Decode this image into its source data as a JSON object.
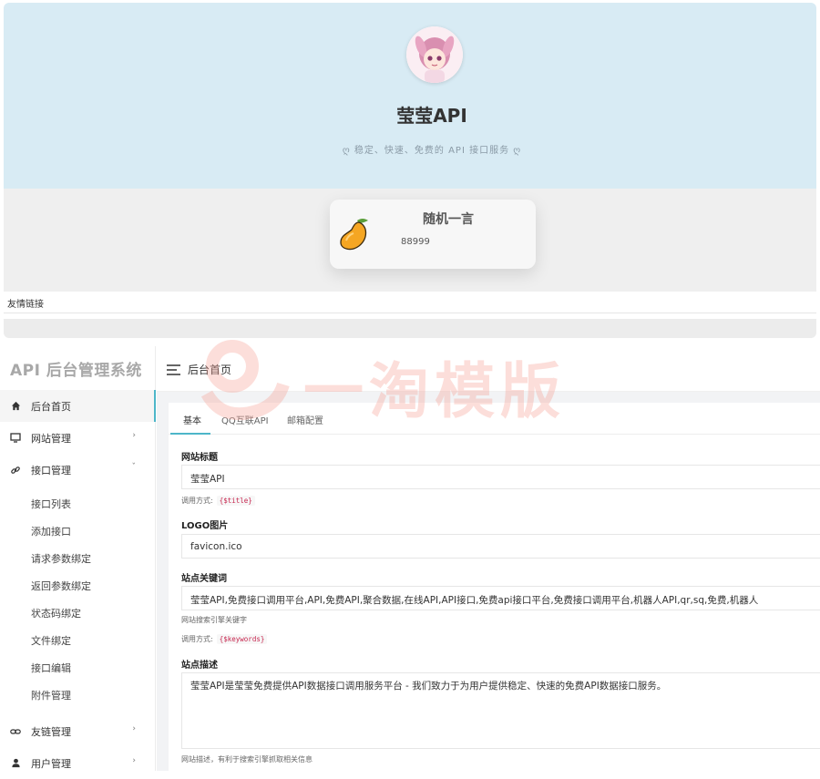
{
  "front": {
    "site_title": "莹莹API",
    "site_desc": "稳定、快速、免费的 API 接口服务",
    "quote": {
      "title": "随机一言",
      "text": "88999"
    },
    "links_label": "友情链接"
  },
  "admin": {
    "brand": "API 后台管理系统",
    "breadcrumb": "后台首页",
    "nav": [
      {
        "label": "后台首页",
        "icon": "home-icon"
      },
      {
        "label": "网站管理",
        "icon": "monitor-icon",
        "chevron": "›"
      },
      {
        "label": "接口管理",
        "icon": "link-icon",
        "chevron": "ˇ"
      }
    ],
    "sub_nav": [
      "接口列表",
      "添加接口",
      "请求参数绑定",
      "返回参数绑定",
      "状态码绑定",
      "文件绑定",
      "接口编辑",
      "附件管理"
    ],
    "nav_bottom": [
      {
        "label": "友链管理",
        "icon": "link-icon",
        "chevron": "›"
      },
      {
        "label": "用户管理",
        "icon": "user-icon",
        "chevron": "›"
      }
    ],
    "tabs": [
      "基本",
      "QQ互联API",
      "邮箱配置"
    ],
    "form": {
      "title_label": "网站标题",
      "title_value": "莹莹API",
      "title_help": "调用方式:",
      "title_code": "{$title}",
      "logo_label": "LOGO图片",
      "logo_value": "favicon.ico",
      "keywords_label": "站点关键词",
      "keywords_value": "莹莹API,免费接口调用平台,API,免费API,聚合数据,在线API,API接口,免费api接口平台,免费接口调用平台,机器人API,qr,sq,免费,机器人",
      "keywords_help": "网站搜索引擎关键字",
      "keywords_help2": "调用方式:",
      "keywords_code": "{$keywords}",
      "desc_label": "站点描述",
      "desc_value": "莹莹API是莹莹免费提供API数据接口调用服务平台 - 我们致力于为用户提供稳定、快速的免费API数据接口服务。",
      "desc_help": "网站描述，有利于搜索引擎抓取相关信息"
    }
  },
  "watermark": "一淘模版",
  "colors": {
    "hero_bg": "#d8ebf4",
    "accent": "#4db6c9",
    "code": "#c7254e"
  }
}
